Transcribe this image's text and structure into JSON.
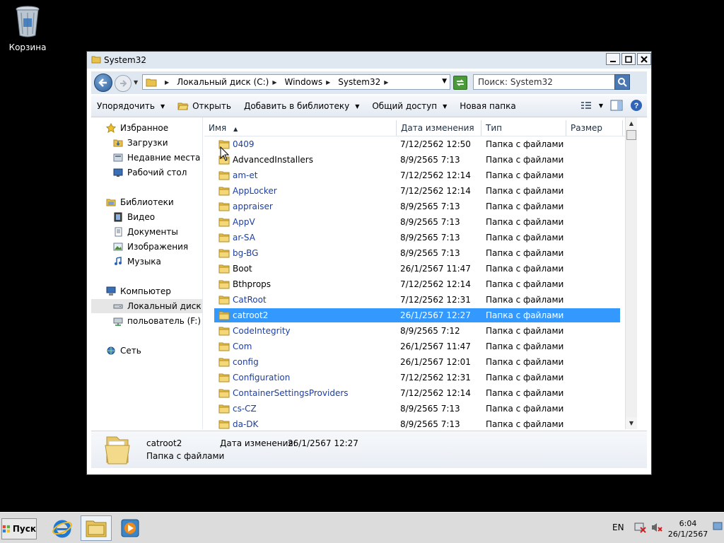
{
  "desktop": {
    "recycle_bin_label": "Корзина"
  },
  "window": {
    "title": "System32",
    "buttons": {
      "minimize": "_",
      "maximize": "□",
      "close": "✕"
    }
  },
  "address": {
    "crumbs": [
      "Локальный диск (C:)",
      "Windows",
      "System32"
    ],
    "search_placeholder": "Поиск: System32"
  },
  "toolbar": {
    "organize": "Упорядочить",
    "open": "Открыть",
    "add_to_library": "Добавить в библиотеку",
    "share": "Общий доступ",
    "new_folder": "Новая папка"
  },
  "nav": {
    "favorites": "Избранное",
    "downloads": "Загрузки",
    "recent": "Недавние места",
    "desktop": "Рабочий стол",
    "libraries": "Библиотеки",
    "video": "Видео",
    "documents": "Документы",
    "images": "Изображения",
    "music": "Музыка",
    "computer": "Компьютер",
    "local_disk": "Локальный диск (C",
    "user_drive": "польователь (F:)",
    "network": "Сеть"
  },
  "columns": {
    "name": "Имя",
    "date": "Дата изменения",
    "type": "Тип",
    "size": "Размер"
  },
  "files": [
    {
      "name": "0409",
      "date": "7/12/2562 12:50",
      "type": "Папка с файлами",
      "link": true
    },
    {
      "name": "AdvancedInstallers",
      "date": "8/9/2565 7:13",
      "type": "Папка с файлами",
      "link": false
    },
    {
      "name": "am-et",
      "date": "7/12/2562 12:14",
      "type": "Папка с файлами",
      "link": true
    },
    {
      "name": "AppLocker",
      "date": "7/12/2562 12:14",
      "type": "Папка с файлами",
      "link": true
    },
    {
      "name": "appraiser",
      "date": "8/9/2565 7:13",
      "type": "Папка с файлами",
      "link": true
    },
    {
      "name": "AppV",
      "date": "8/9/2565 7:13",
      "type": "Папка с файлами",
      "link": true
    },
    {
      "name": "ar-SA",
      "date": "8/9/2565 7:13",
      "type": "Папка с файлами",
      "link": true
    },
    {
      "name": "bg-BG",
      "date": "8/9/2565 7:13",
      "type": "Папка с файлами",
      "link": true
    },
    {
      "name": "Boot",
      "date": "26/1/2567 11:47",
      "type": "Папка с файлами",
      "link": false
    },
    {
      "name": "Bthprops",
      "date": "7/12/2562 12:14",
      "type": "Папка с файлами",
      "link": false
    },
    {
      "name": "CatRoot",
      "date": "7/12/2562 12:31",
      "type": "Папка с файлами",
      "link": true
    },
    {
      "name": "catroot2",
      "date": "26/1/2567 12:27",
      "type": "Папка с файлами",
      "link": true,
      "selected": true
    },
    {
      "name": "CodeIntegrity",
      "date": "8/9/2565 7:12",
      "type": "Папка с файлами",
      "link": true
    },
    {
      "name": "Com",
      "date": "26/1/2567 11:47",
      "type": "Папка с файлами",
      "link": true
    },
    {
      "name": "config",
      "date": "26/1/2567 12:01",
      "type": "Папка с файлами",
      "link": true
    },
    {
      "name": "Configuration",
      "date": "7/12/2562 12:31",
      "type": "Папка с файлами",
      "link": true
    },
    {
      "name": "ContainerSettingsProviders",
      "date": "7/12/2562 12:14",
      "type": "Папка с файлами",
      "link": true
    },
    {
      "name": "cs-CZ",
      "date": "8/9/2565 7:13",
      "type": "Папка с файлами",
      "link": true
    },
    {
      "name": "da-DK",
      "date": "8/9/2565 7:13",
      "type": "Папка с файлами",
      "link": true
    }
  ],
  "details": {
    "name": "catroot2",
    "type": "Папка с файлами",
    "date_label": "Дата изменения:",
    "date_value": "26/1/2567 12:27"
  },
  "taskbar": {
    "start_label": "Пуск",
    "lang": "EN",
    "time": "6:04",
    "date": "26/1/2567"
  },
  "colors": {
    "selection": "#3399ff",
    "link": "#1b3ea6",
    "titlebar": "#dfe7f1"
  }
}
